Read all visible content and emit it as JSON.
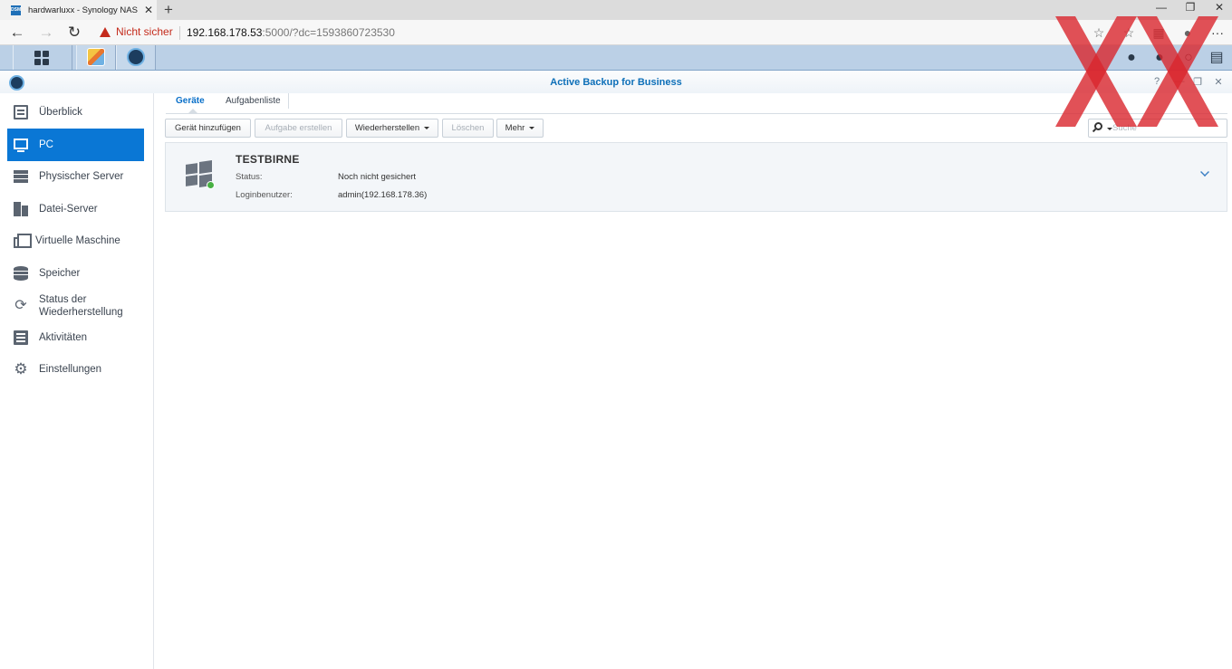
{
  "browser": {
    "tab_title": "hardwarluxx - Synology NAS",
    "favicon_text": "DSM",
    "tab_close": "✕",
    "new_tab": "+",
    "security_label": "Nicht sicher",
    "url_host": "192.168.178.53",
    "url_rest": ":5000/?dc=1593860723530",
    "more_menu": "···"
  },
  "app": {
    "title": "Active Backup for Business"
  },
  "sidebar": {
    "items": [
      {
        "label": "Überblick",
        "icon": "overview-icon"
      },
      {
        "label": "PC",
        "icon": "pc-icon"
      },
      {
        "label": "Physischer Server",
        "icon": "server-icon"
      },
      {
        "label": "Datei-Server",
        "icon": "file-server-icon"
      },
      {
        "label": "Virtuelle Maschine",
        "icon": "vm-icon"
      },
      {
        "label": "Speicher",
        "icon": "storage-icon"
      },
      {
        "label": "Status der Wiederherstellung",
        "icon": "restore-status-icon"
      },
      {
        "label": "Aktivitäten",
        "icon": "activity-icon"
      },
      {
        "label": "Einstellungen",
        "icon": "settings-icon"
      }
    ],
    "active_index": 1
  },
  "main": {
    "tabs": [
      {
        "label": "Geräte"
      },
      {
        "label": "Aufgabenliste"
      }
    ],
    "toolbar": {
      "add_device": "Gerät hinzufügen",
      "create_task": "Aufgabe erstellen",
      "restore": "Wiederherstellen",
      "delete": "Löschen",
      "more": "Mehr"
    },
    "search": {
      "placeholder": "Suche"
    },
    "device": {
      "name": "TESTBIRNE",
      "status_label": "Status:",
      "status_value": "Noch nicht gesichert",
      "login_label": "Loginbenutzer:",
      "login_value": "admin(192.168.178.36)",
      "online_color": "#47b043"
    }
  },
  "colors": {
    "accent": "#0a77d5",
    "title_blue": "#0d6fb8",
    "watermark_red": "#d9262d"
  }
}
